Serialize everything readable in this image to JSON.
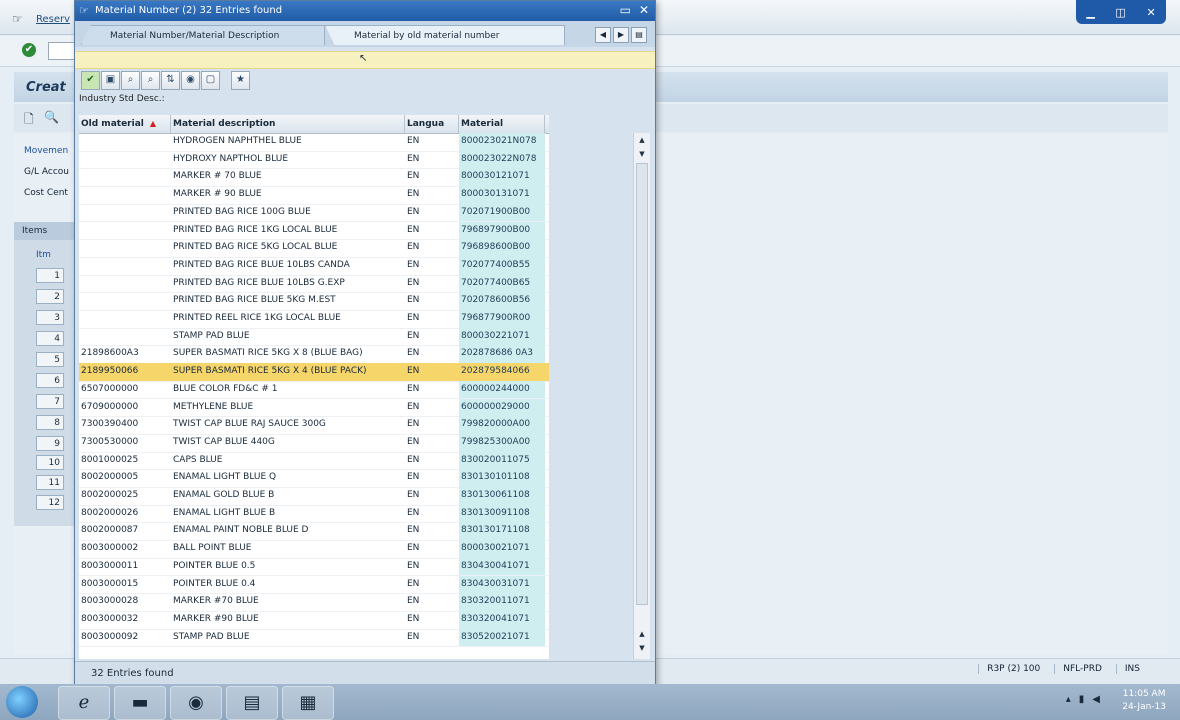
{
  "background": {
    "title": "Reserv",
    "header": "Creat",
    "labels": [
      "Movemen",
      "G/L Accou",
      "Cost Cent"
    ],
    "items_tab": "Items",
    "items_header": "Itm",
    "row_numbers": [
      "1",
      "2",
      "3",
      "4",
      "5",
      "6",
      "7",
      "8",
      "9",
      "10",
      "11",
      "12"
    ],
    "status": {
      "system": "R3P (2) 100",
      "server": "NFL-PRD",
      "mode": "INS"
    }
  },
  "dialog": {
    "title": "Material Number (2)   32 Entries found",
    "tabs": [
      "Material Number/Material Description",
      "Material by old material number"
    ],
    "filter_label": "Industry Std Desc.:",
    "columns": [
      "Old material",
      "Material description",
      "Langua",
      "Material"
    ],
    "rows": [
      [
        "",
        "HYDROGEN NAPHTHEL BLUE",
        "EN",
        "800023021N078"
      ],
      [
        "",
        "HYDROXY NAPTHOL BLUE",
        "EN",
        "800023022N078"
      ],
      [
        "",
        "MARKER # 70 BLUE",
        "EN",
        "800030121071"
      ],
      [
        "",
        "MARKER # 90 BLUE",
        "EN",
        "800030131071"
      ],
      [
        "",
        "PRINTED BAG RICE 100G BLUE",
        "EN",
        "702071900B00"
      ],
      [
        "",
        "PRINTED BAG RICE 1KG LOCAL BLUE",
        "EN",
        "796897900B00"
      ],
      [
        "",
        "PRINTED BAG RICE 5KG LOCAL BLUE",
        "EN",
        "796898600B00"
      ],
      [
        "",
        "PRINTED BAG RICE BLUE 10LBS CANDA",
        "EN",
        "702077400B55"
      ],
      [
        "",
        "PRINTED BAG RICE BLUE 10LBS G.EXP",
        "EN",
        "702077400B65"
      ],
      [
        "",
        "PRINTED BAG RICE BLUE 5KG M.EST",
        "EN",
        "702078600B56"
      ],
      [
        "",
        "PRINTED REEL RICE 1KG LOCAL BLUE",
        "EN",
        "796877900R00"
      ],
      [
        "",
        "STAMP PAD BLUE",
        "EN",
        "800030221071"
      ],
      [
        "21898600A3",
        "SUPER BASMATI RICE 5KG X 8 (BLUE BAG)",
        "EN",
        "202878686 0A3"
      ],
      [
        "2189950066",
        "SUPER BASMATI RICE 5KG X 4 (BLUE PACK)",
        "EN",
        "202879584066"
      ],
      [
        "6507000000",
        "BLUE COLOR FD&C # 1",
        "EN",
        "600000244000"
      ],
      [
        "6709000000",
        "METHYLENE BLUE",
        "EN",
        "600000029000"
      ],
      [
        "7300390400",
        "TWIST CAP BLUE RAJ SAUCE 300G",
        "EN",
        "799820000A00"
      ],
      [
        "7300530000",
        "TWIST CAP BLUE 440G",
        "EN",
        "799825300A00"
      ],
      [
        "8001000025",
        "CAPS BLUE",
        "EN",
        "830020011075"
      ],
      [
        "8002000005",
        "ENAMAL LIGHT BLUE Q",
        "EN",
        "830130101108"
      ],
      [
        "8002000025",
        "ENAMAL GOLD BLUE B",
        "EN",
        "830130061108"
      ],
      [
        "8002000026",
        "ENAMAL LIGHT BLUE B",
        "EN",
        "830130091108"
      ],
      [
        "8002000087",
        "ENAMAL PAINT NOBLE BLUE D",
        "EN",
        "830130171108"
      ],
      [
        "8003000002",
        "BALL POINT BLUE",
        "EN",
        "800030021071"
      ],
      [
        "8003000011",
        "POINTER BLUE 0.5",
        "EN",
        "830430041071"
      ],
      [
        "8003000015",
        "POINTER BLUE 0.4",
        "EN",
        "830430031071"
      ],
      [
        "8003000028",
        "MARKER #70 BLUE",
        "EN",
        "830320011071"
      ],
      [
        "8003000032",
        "MARKER #90 BLUE",
        "EN",
        "830320041071"
      ],
      [
        "8003000092",
        "STAMP PAD BLUE",
        "EN",
        "830520021071"
      ]
    ],
    "selected_row": 13,
    "footer": "32 Entries found"
  },
  "taskbar": {
    "time": "11:05 AM",
    "date": "24-Jan-13"
  }
}
